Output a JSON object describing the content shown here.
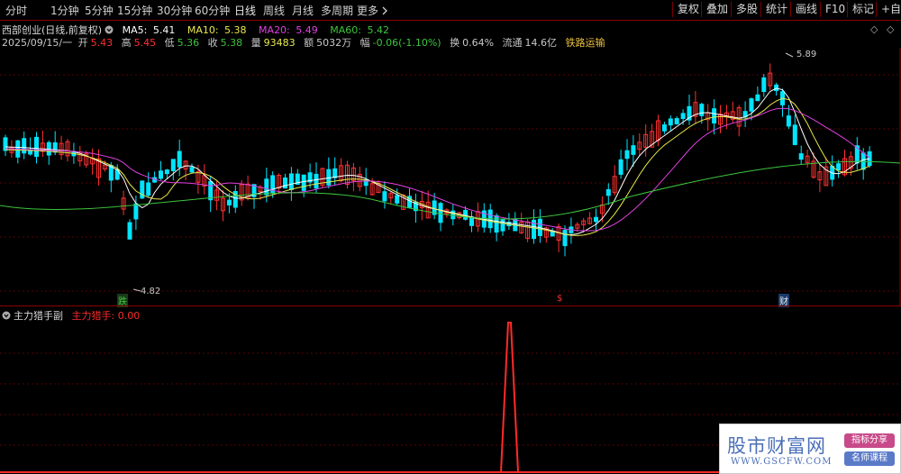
{
  "toolbar": {
    "periods": [
      "分时",
      "1分钟",
      "5分钟",
      "15分钟",
      "30分钟",
      "60分钟",
      "日线",
      "周线",
      "月线",
      "多周期",
      "更多"
    ],
    "active_period": "日线",
    "more_icon": "chevron-right-icon",
    "right_buttons": [
      "复权",
      "叠加",
      "多股",
      "统计",
      "画线",
      "F10",
      "标记",
      "+自选"
    ]
  },
  "stock": {
    "name": "西部创业",
    "mode": "(日线,前复权)",
    "date": "2025/09/15/一",
    "open_label": "开",
    "open": "5.43",
    "high_label": "高",
    "high": "5.45",
    "low_label": "低",
    "low": "5.36",
    "close_label": "收",
    "close": "5.38",
    "volume_label": "量",
    "volume": "93483",
    "amount_label": "额",
    "amount": "5032万",
    "change_label": "幅",
    "change": "-0.06(-1.10%)",
    "turnover_label": "换",
    "turnover": "0.64%",
    "float_label": "流通",
    "float": "14.6亿",
    "concept": "铁路运输"
  },
  "ma": {
    "ma5_label": "MA5:",
    "ma5": "5.41",
    "ma10_label": "MA10:",
    "ma10": "5.38",
    "ma20_label": "MA20:",
    "ma20": "5.49",
    "ma60_label": "MA60:",
    "ma60": "5.42",
    "colors": {
      "ma5": "#ffffff",
      "ma10": "#e8e84a",
      "ma20": "#e040e0",
      "ma60": "#3cc43c"
    }
  },
  "annotations": {
    "high_value": "5.89",
    "low_value": "4.82",
    "marker_die": "跌",
    "marker_s": "$",
    "marker_cai": "财"
  },
  "indicator": {
    "name": "主力猎手副",
    "line_label": "主力猎手:",
    "line_value": "0.00",
    "line_color": "#ff2a2a"
  },
  "watermark": {
    "title": "股市财富网",
    "url": "WWW.GSCFW.COM",
    "tag1": "指标分享",
    "tag2": "名师课程"
  },
  "colors": {
    "up": "#ff3030",
    "down": "#00e5ff",
    "grid": "#5a0000",
    "frame": "#8b0000"
  }
}
